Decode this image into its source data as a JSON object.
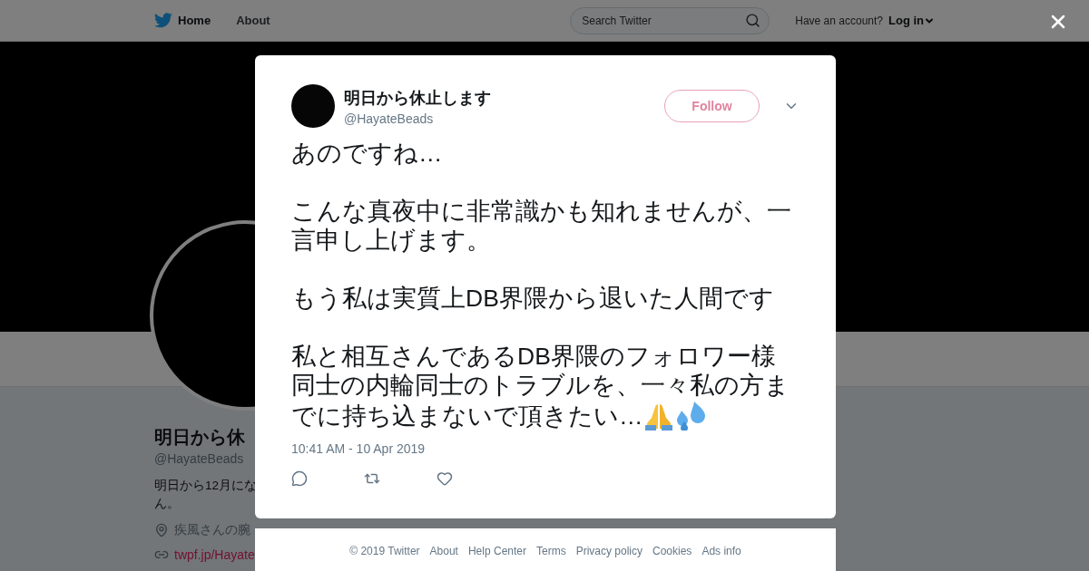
{
  "nav": {
    "items": [
      {
        "label": "Home",
        "selected": true
      },
      {
        "label": "About",
        "selected": false
      }
    ],
    "search": {
      "placeholder": "Search Twitter"
    },
    "account_prompt": "Have an account?",
    "login": "Log in"
  },
  "profile": {
    "name": "明日から休",
    "handle": "@HayateBeads",
    "bio_lines": [
      "明日から12月にな",
      "ん。"
    ],
    "location": "疾風さんの腕",
    "link": "twpf.jp/Hayate"
  },
  "tweet": {
    "name": "明日から休止します",
    "handle": "@HayateBeads",
    "follow": "Follow",
    "paragraphs": [
      "あのですね…",
      "こんな真夜中に非常識かも知れませんが、一言申し上げます。",
      "もう私は実質上DB界隈から退いた人間です",
      "私と相互さんであるDB界隈のフォロワー様同士の内輪同士のトラブルを、一々私の方ま"
    ],
    "last_line": "でに持ち込まないで頂きたい…",
    "timestamp": "10:41 AM - 10 Apr 2019"
  },
  "footer": [
    "© 2019 Twitter",
    "About",
    "Help Center",
    "Terms",
    "Privacy policy",
    "Cookies",
    "Ads info"
  ]
}
